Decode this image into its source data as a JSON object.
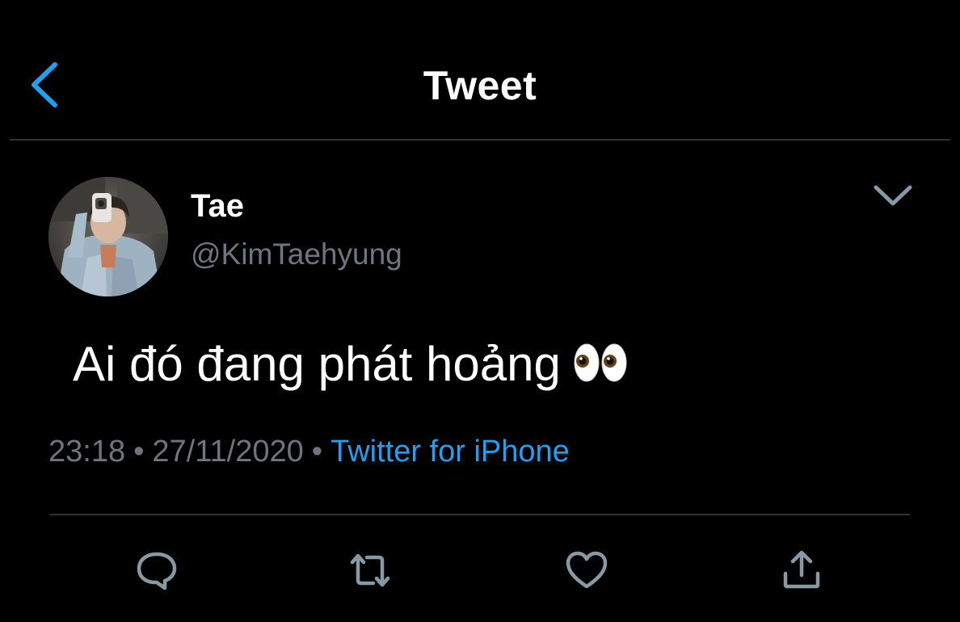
{
  "header": {
    "title": "Tweet",
    "back_icon": "chevron-left-icon"
  },
  "tweet": {
    "author": {
      "display_name": "Tae",
      "username": "@KimTaehyung"
    },
    "text": "Ai đó đang phát hoảng",
    "emoji": "eyes-emoji",
    "time": "23:18",
    "date": "27/11/2020",
    "separator": "•",
    "source": "Twitter for iPhone"
  },
  "actions": [
    {
      "name": "reply",
      "icon": "reply-icon"
    },
    {
      "name": "retweet",
      "icon": "retweet-icon"
    },
    {
      "name": "like",
      "icon": "heart-icon"
    },
    {
      "name": "share",
      "icon": "share-icon"
    }
  ],
  "colors": {
    "background": "#000000",
    "accent": "#1da1f2",
    "secondary_text": "#6e767d",
    "icon": "#8899a6",
    "divider": "#2f3336"
  }
}
